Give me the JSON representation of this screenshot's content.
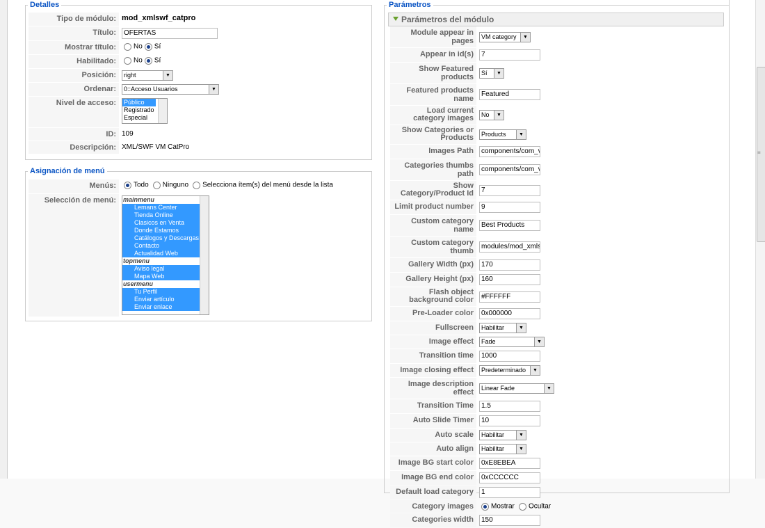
{
  "detalles": {
    "legend": "Detalles",
    "rows": {
      "tipo_label": "Tipo de módulo:",
      "tipo_value": "mod_xmlswf_catpro",
      "titulo_label": "Título:",
      "titulo_value": "OFERTAS",
      "mostrar_label": "Mostrar título:",
      "mostrar_no": "No",
      "mostrar_si": "Sí",
      "habilitado_label": "Habilitado:",
      "habilitado_no": "No",
      "habilitado_si": "Sí",
      "posicion_label": "Posición:",
      "posicion_value": "right",
      "ordenar_label": "Ordenar:",
      "ordenar_value": "0::Acceso Usuarios",
      "nivel_label": "Nivel de acceso:",
      "nivel_options": [
        "Público",
        "Registrado",
        "Especial"
      ],
      "id_label": "ID:",
      "id_value": "109",
      "descripcion_label": "Descripción:",
      "descripcion_value": "XML/SWF VM CatPro"
    }
  },
  "asignacion": {
    "legend": "Asignación de menú",
    "menus_label": "Menús:",
    "opt_todo": "Todo",
    "opt_ninguno": "Ninguno",
    "opt_selecciona": "Selecciona ítem(s) del menú desde la lista",
    "seleccion_label": "Selección de menú:",
    "groups": [
      {
        "name": "mainmenu",
        "items": [
          "Lemans Center",
          "Tienda Online",
          "Clasicos en Venta",
          "Donde Estamos",
          "Catálogos y Descargas",
          "Contacto",
          "Actualidad Web"
        ]
      },
      {
        "name": "topmenu",
        "items": [
          "Aviso legal",
          "Mapa Web"
        ]
      },
      {
        "name": "usermenu",
        "items": [
          "Tu Perfil",
          "Enviar artículo",
          "Enviar enlace"
        ]
      }
    ]
  },
  "parametros": {
    "legend": "Parámetros",
    "panel_title": "Parámetros del módulo",
    "rows": [
      {
        "label": "Module appear in pages",
        "type": "select",
        "value": "VM category",
        "w": 70
      },
      {
        "label": "Appear in id(s)",
        "type": "text",
        "value": "7",
        "w": 82
      },
      {
        "label": "Show Featured products",
        "type": "select",
        "value": "Sí",
        "w": 32
      },
      {
        "label": "Featured products name",
        "type": "text",
        "value": "Featured",
        "w": 82
      },
      {
        "label": "Load current category images",
        "type": "select",
        "value": "No",
        "w": 32,
        "tall": true
      },
      {
        "label": "Show Categories or Products",
        "type": "select",
        "value": "Products",
        "w": 64,
        "tall": true
      },
      {
        "label": "Images Path",
        "type": "text",
        "value": "components/com_vir",
        "w": 82
      },
      {
        "label": "Categories thumbs path",
        "type": "text",
        "value": "components/com_vir",
        "w": 82
      },
      {
        "label": "Show Category/Product Id",
        "type": "text",
        "value": "7",
        "w": 82,
        "tall": true
      },
      {
        "label": "Limit product number",
        "type": "text",
        "value": "9",
        "w": 82
      },
      {
        "label": "Custom category name",
        "type": "text",
        "value": "Best Products",
        "w": 82
      },
      {
        "label": "Custom category thumb",
        "type": "text",
        "value": "modules/mod_xmlsw",
        "w": 82
      },
      {
        "label": "Gallery Width (px)",
        "type": "text",
        "value": "170",
        "w": 82
      },
      {
        "label": "Gallery Height (px)",
        "type": "text",
        "value": "160",
        "w": 82
      },
      {
        "label": "Flash object background color",
        "type": "text",
        "value": "#FFFFFF",
        "w": 82,
        "tall": true
      },
      {
        "label": "Pre-Loader color",
        "type": "text",
        "value": "0x000000",
        "w": 82
      },
      {
        "label": "Fullscreen",
        "type": "select",
        "value": "Habilitar",
        "w": 64
      },
      {
        "label": "Image effect",
        "type": "select",
        "value": "Fade",
        "w": 90
      },
      {
        "label": "Transition time",
        "type": "text",
        "value": "1000",
        "w": 82
      },
      {
        "label": "Image closing effect",
        "type": "select",
        "value": "Predeterminado",
        "w": 84
      },
      {
        "label": "Image description effect",
        "type": "select",
        "value": "Linear Fade",
        "w": 104
      },
      {
        "label": "Transition Time",
        "type": "text",
        "value": "1.5",
        "w": 82
      },
      {
        "label": "Auto Slide Timer",
        "type": "text",
        "value": "10",
        "w": 82
      },
      {
        "label": "Auto scale",
        "type": "select",
        "value": "Habilitar",
        "w": 64
      },
      {
        "label": "Auto align",
        "type": "select",
        "value": "Habilitar",
        "w": 64
      },
      {
        "label": "Image BG start color",
        "type": "text",
        "value": "0xE8EBEA",
        "w": 82
      },
      {
        "label": "Image BG end color",
        "type": "text",
        "value": "0xCCCCCC",
        "w": 82
      },
      {
        "label": "Default load category",
        "type": "text",
        "value": "1",
        "w": 82
      },
      {
        "label": "Category images",
        "type": "radio",
        "value": "Mostrar",
        "alt": "Ocultar"
      },
      {
        "label": "Categories width",
        "type": "text",
        "value": "150",
        "w": 82
      }
    ]
  }
}
